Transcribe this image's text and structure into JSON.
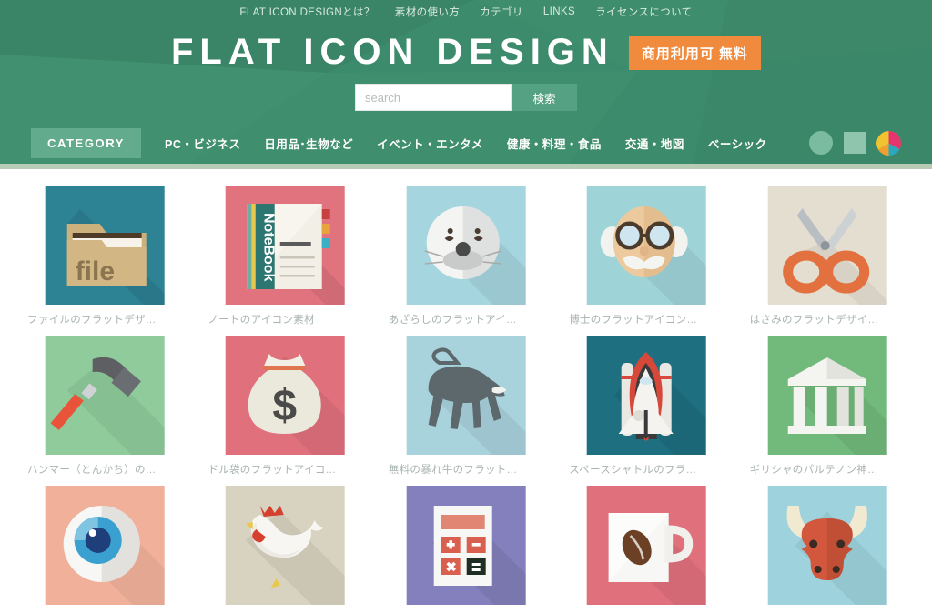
{
  "topnav": {
    "items": [
      {
        "label": "FLAT ICON DESIGNとは？",
        "name": "topnav-about"
      },
      {
        "label": "素材の使い方",
        "name": "topnav-howto"
      },
      {
        "label": "カテゴリ",
        "name": "topnav-category"
      },
      {
        "label": "LINKS",
        "name": "topnav-links"
      },
      {
        "label": "ライセンスについて",
        "name": "topnav-license"
      }
    ]
  },
  "brand": {
    "logo": "FLAT ICON DESIGN",
    "badge": "商用利用可 無料"
  },
  "search": {
    "placeholder": "search",
    "value": "",
    "button_label": "検索"
  },
  "category_bar": {
    "active_label": "CATEGORY",
    "items": [
      {
        "label": "PC・ビジネス",
        "name": "category-pc-business"
      },
      {
        "label": "日用品･生物など",
        "name": "category-daily-creatures"
      },
      {
        "label": "イベント・エンタメ",
        "name": "category-event-entertainment"
      },
      {
        "label": "健康・料理・食品",
        "name": "category-health-cooking-food"
      },
      {
        "label": "交通・地図",
        "name": "category-transport-map"
      },
      {
        "label": "ベーシック",
        "name": "category-basic"
      }
    ],
    "shape_toggles": [
      {
        "name": "circle-shape-icon",
        "shape": "circle"
      },
      {
        "name": "square-shape-icon",
        "shape": "square"
      },
      {
        "name": "color-pie-icon",
        "shape": "pie"
      }
    ]
  },
  "colors": {
    "header_green": "#3d8b6d",
    "accent_orange": "#f08a3c",
    "active_green": "#63ab8d",
    "search_btn": "#54a183",
    "label_gray": "#a9b4b2"
  },
  "grid": {
    "items": [
      {
        "label": "ファイルのフラットデザ…",
        "name": "icon-card-file",
        "icon": "file-folder-icon",
        "bg": "#2d8294"
      },
      {
        "label": "ノートのアイコン素材",
        "name": "icon-card-notebook",
        "icon": "notebook-icon",
        "bg": "#e0737d"
      },
      {
        "label": "あざらしのフラットアイ…",
        "name": "icon-card-seal",
        "icon": "seal-icon",
        "bg": "#a5d5de"
      },
      {
        "label": "博士のフラットアイコン…",
        "name": "icon-card-professor",
        "icon": "professor-icon",
        "bg": "#9ed3d8"
      },
      {
        "label": "はさみのフラットデザイ…",
        "name": "icon-card-scissors",
        "icon": "scissors-icon",
        "bg": "#e3ded0"
      },
      {
        "label": "ハンマー（とんかち）の…",
        "name": "icon-card-hammer",
        "icon": "hammer-icon",
        "bg": "#8fcb9b"
      },
      {
        "label": "ドル袋のフラットアイコ…",
        "name": "icon-card-money-bag",
        "icon": "money-bag-icon",
        "bg": "#e0707c"
      },
      {
        "label": "無料の暴れ牛のフラット…",
        "name": "icon-card-raging-bull",
        "icon": "bull-body-icon",
        "bg": "#a8d2dc"
      },
      {
        "label": "スペースシャトルのフラ…",
        "name": "icon-card-space-shuttle",
        "icon": "space-shuttle-icon",
        "bg": "#1e6f80"
      },
      {
        "label": "ギリシャのパルテノン神…",
        "name": "icon-card-parthenon",
        "icon": "parthenon-icon",
        "bg": "#72b97c"
      },
      {
        "label": "",
        "name": "icon-card-eye",
        "icon": "eye-icon",
        "bg": "#f0b09a"
      },
      {
        "label": "",
        "name": "icon-card-chicken",
        "icon": "chicken-icon",
        "bg": "#d8d2c0"
      },
      {
        "label": "",
        "name": "icon-card-calculator",
        "icon": "calculator-icon",
        "bg": "#8480bd"
      },
      {
        "label": "",
        "name": "icon-card-coffee-cup",
        "icon": "coffee-cup-icon",
        "bg": "#e0707c"
      },
      {
        "label": "",
        "name": "icon-card-bull-head",
        "icon": "bull-head-icon",
        "bg": "#9ed3dd"
      }
    ]
  }
}
